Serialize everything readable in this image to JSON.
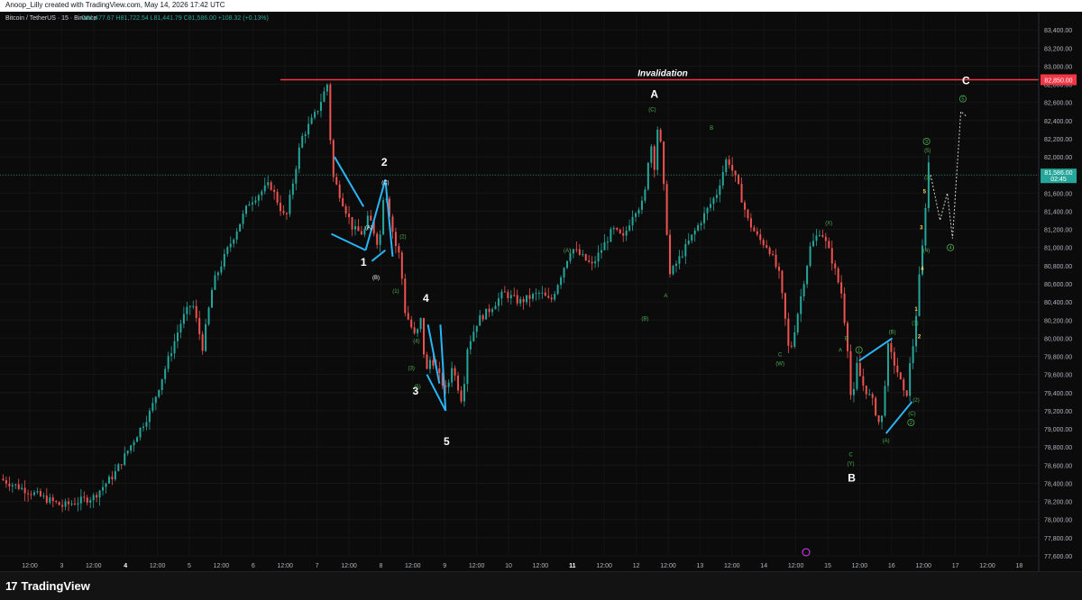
{
  "header": {
    "attribution": "Anoop_Lilly created with TradingView.com, May 14, 2026 17:42 UTC"
  },
  "symbol_line": {
    "name": "Bitcoin / TetherUS · 15 · Binance",
    "ohlc": [
      {
        "label": "O",
        "value": "81,477.67"
      },
      {
        "label": "H",
        "value": "81,722.54"
      },
      {
        "label": "L",
        "value": "81,441.79"
      },
      {
        "label": "C",
        "value": "81,586.00"
      }
    ],
    "change": "+108.32 (+0.13%)"
  },
  "footer": {
    "logo_mark": "17",
    "logo_text": "TradingView"
  },
  "colors": {
    "background": "#0b0b0b",
    "up": "#26a69a",
    "down": "#ef5350",
    "wave_line": "#29b6f6",
    "invalidation": "#f23645",
    "label_green": "#4caf50",
    "label_yellow": "#ffd54f",
    "label_white": "#ffffff"
  },
  "chart_data": {
    "type": "candlestick",
    "ylim": [
      77600,
      83600
    ],
    "y_ticks": [
      77600,
      77800,
      78000,
      78200,
      78400,
      78600,
      78800,
      79000,
      79200,
      79400,
      79600,
      79800,
      80000,
      80200,
      80400,
      80600,
      80800,
      81000,
      81200,
      81400,
      81600,
      81800,
      82000,
      82200,
      82400,
      82600,
      82800,
      83000,
      83200,
      83400
    ],
    "y_tick_labels": [
      "77,600.00",
      "77,800.00",
      "78,000.00",
      "78,200.00",
      "78,400.00",
      "78,600.00",
      "78,800.00",
      "79,000.00",
      "79,200.00",
      "79,400.00",
      "79,600.00",
      "79,800.00",
      "80,000.00",
      "80,200.00",
      "80,400.00",
      "80,600.00",
      "80,800.00",
      "81,000.00",
      "81,200.00",
      "81,400.00",
      "81,600.00",
      "81,800.00",
      "82,000.00",
      "82,200.00",
      "82,400.00",
      "82,600.00",
      "82,800.00",
      "83,000.00",
      "83,200.00",
      "83,400.00"
    ],
    "x_tick_labels": [
      "12:00",
      "3",
      "12:00",
      "4",
      "12:00",
      "5",
      "12:00",
      "6",
      "12:00",
      "7",
      "12:00",
      "8",
      "12:00",
      "9",
      "12:00",
      "10",
      "12:00",
      "11",
      "12:00",
      "12",
      "12:00",
      "13",
      "12:00",
      "14",
      "12:00",
      "15",
      "12:00",
      "16",
      "12:00",
      "17",
      "12:00",
      "18"
    ],
    "x_tick_bold": [
      "4",
      "11"
    ],
    "price_path": [
      [
        0,
        78450
      ],
      [
        3,
        78300
      ],
      [
        6,
        78150
      ],
      [
        9,
        78250
      ],
      [
        11,
        78500
      ],
      [
        13,
        78900
      ],
      [
        14.5,
        79200
      ],
      [
        16,
        79700
      ],
      [
        17.5,
        80200
      ],
      [
        18.5,
        80400
      ],
      [
        19.5,
        79900
      ],
      [
        20.5,
        80600
      ],
      [
        22,
        81000
      ],
      [
        24,
        81500
      ],
      [
        26,
        81700
      ],
      [
        27.5,
        81300
      ],
      [
        29,
        82200
      ],
      [
        30.5,
        82500
      ],
      [
        31.5,
        82800
      ],
      [
        32,
        81800
      ],
      [
        33,
        81500
      ],
      [
        34,
        81200
      ],
      [
        35,
        81150
      ],
      [
        35.5,
        81350
      ],
      [
        36.5,
        81000
      ],
      [
        37,
        81700
      ],
      [
        38,
        81050
      ],
      [
        38.5,
        80900
      ],
      [
        39,
        80300
      ],
      [
        40,
        80000
      ],
      [
        40.5,
        80200
      ],
      [
        41,
        79600
      ],
      [
        41.5,
        79800
      ],
      [
        42,
        79650
      ],
      [
        43,
        79400
      ],
      [
        43.5,
        79700
      ],
      [
        44.5,
        79300
      ],
      [
        45,
        79900
      ],
      [
        46,
        80200
      ],
      [
        47,
        80300
      ],
      [
        48.5,
        80500
      ],
      [
        50,
        80400
      ],
      [
        52,
        80500
      ],
      [
        53,
        80400
      ],
      [
        54,
        80700
      ],
      [
        55,
        81000
      ],
      [
        56,
        80900
      ],
      [
        57,
        80800
      ],
      [
        58,
        81000
      ],
      [
        59,
        81200
      ],
      [
        60,
        81100
      ],
      [
        61,
        81400
      ],
      [
        62,
        81500
      ],
      [
        62.6,
        82200
      ],
      [
        63,
        81900
      ],
      [
        63.4,
        82450
      ],
      [
        64,
        81500
      ],
      [
        64.5,
        80700
      ],
      [
        65,
        80800
      ],
      [
        66,
        81000
      ],
      [
        67,
        81200
      ],
      [
        68,
        81400
      ],
      [
        69,
        81600
      ],
      [
        70,
        82000
      ],
      [
        71,
        81700
      ],
      [
        72,
        81300
      ],
      [
        73,
        81100
      ],
      [
        74,
        81000
      ],
      [
        75,
        80700
      ],
      [
        75.5,
        80300
      ],
      [
        76,
        79800
      ],
      [
        77,
        80400
      ],
      [
        78,
        81000
      ],
      [
        79,
        81200
      ],
      [
        80,
        80900
      ],
      [
        81,
        80500
      ],
      [
        81.6,
        79900
      ],
      [
        82,
        79200
      ],
      [
        82.5,
        79700
      ],
      [
        83,
        79500
      ],
      [
        84,
        79300
      ],
      [
        84.8,
        79000
      ],
      [
        85.5,
        79900
      ],
      [
        86.5,
        79600
      ],
      [
        87.2,
        79300
      ],
      [
        87.6,
        79700
      ],
      [
        88,
        80000
      ],
      [
        88.6,
        80800
      ],
      [
        89,
        81200
      ],
      [
        89.3,
        82000
      ],
      [
        89.6,
        81800
      ]
    ],
    "forecast_path": [
      [
        89.6,
        81800
      ],
      [
        90.5,
        81300
      ],
      [
        91.2,
        81600
      ],
      [
        91.7,
        81100
      ],
      [
        92.5,
        82500
      ],
      [
        93,
        82450
      ]
    ],
    "invalidation_level": 82850,
    "current_price_label": "81,586.00",
    "current_price_countdown": "02:45",
    "invalidation_price_label": "82,850.00",
    "annotation_text": "Invalidation",
    "wave_labels_major": [
      {
        "t": "1",
        "x": 35,
        "y": 80800
      },
      {
        "t": "2",
        "x": 37,
        "y": 81900
      },
      {
        "t": "3",
        "x": 40,
        "y": 79380
      },
      {
        "t": "4",
        "x": 41,
        "y": 80400
      },
      {
        "t": "5",
        "x": 43,
        "y": 78820
      },
      {
        "t": "A",
        "x": 63,
        "y": 82650
      },
      {
        "t": "B",
        "x": 82,
        "y": 78420
      },
      {
        "t": "C",
        "x": 93,
        "y": 82800
      }
    ],
    "wave_labels_minor_white": [
      {
        "t": "(A)",
        "x": 35.5,
        "y": 81200
      },
      {
        "t": "(B)",
        "x": 36.2,
        "y": 80650
      },
      {
        "t": "(C)",
        "x": 37.1,
        "y": 81700
      }
    ],
    "wave_labels_minor_green": [
      {
        "t": "(2)",
        "x": 38.8,
        "y": 81100
      },
      {
        "t": "(1)",
        "x": 38.1,
        "y": 80500
      },
      {
        "t": "(4)",
        "x": 40.1,
        "y": 79950
      },
      {
        "t": "(3)",
        "x": 39.6,
        "y": 79650
      },
      {
        "t": "(5)",
        "x": 40.2,
        "y": 79450
      },
      {
        "t": "(A)",
        "x": 54.6,
        "y": 80950
      },
      {
        "t": "(B)",
        "x": 62.1,
        "y": 80200
      },
      {
        "t": "(C)",
        "x": 62.8,
        "y": 82500
      },
      {
        "t": "A",
        "x": 64.1,
        "y": 80450
      },
      {
        "t": "B",
        "x": 68.5,
        "y": 82300
      },
      {
        "t": "(X)",
        "x": 79.8,
        "y": 81250
      },
      {
        "t": "C",
        "x": 75.1,
        "y": 79800
      },
      {
        "t": "(W)",
        "x": 75.1,
        "y": 79700
      },
      {
        "t": "A",
        "x": 80.9,
        "y": 79850
      },
      {
        "t": "B",
        "x": 81.5,
        "y": 79980
      },
      {
        "t": "C",
        "x": 81.9,
        "y": 78700
      },
      {
        "t": "(Y)",
        "x": 81.9,
        "y": 78600
      },
      {
        "t": "(B)",
        "x": 85.9,
        "y": 80050
      },
      {
        "t": "(A)",
        "x": 85.3,
        "y": 78850
      },
      {
        "t": "(C)",
        "x": 87.8,
        "y": 79150
      },
      {
        "t": "(2)",
        "x": 88.2,
        "y": 79300
      },
      {
        "t": "(1)",
        "x": 88.1,
        "y": 80150
      },
      {
        "t": "(4)",
        "x": 89.2,
        "y": 80950
      },
      {
        "t": "(5)",
        "x": 89.3,
        "y": 82050
      },
      {
        "t": "(3)",
        "x": 89.3,
        "y": 81750
      }
    ],
    "wave_labels_circled": [
      {
        "t": "1",
        "x": 82.7,
        "y": 79850
      },
      {
        "t": "2",
        "x": 87.7,
        "y": 79050
      },
      {
        "t": "3",
        "x": 89.2,
        "y": 82150
      },
      {
        "t": "4",
        "x": 91.5,
        "y": 80980
      },
      {
        "t": "5",
        "x": 92.7,
        "y": 82620
      }
    ],
    "wave_labels_yellow": [
      {
        "t": "1",
        "x": 88.2,
        "y": 80300
      },
      {
        "t": "2",
        "x": 88.5,
        "y": 80000
      },
      {
        "t": "3",
        "x": 88.7,
        "y": 81200
      },
      {
        "t": "4",
        "x": 88.8,
        "y": 80750
      },
      {
        "t": "5",
        "x": 89.0,
        "y": 81600
      }
    ],
    "blue_lines": [
      [
        [
          32.2,
          82000
        ],
        [
          35,
          81450
        ]
      ],
      [
        [
          31.9,
          81150
        ],
        [
          35.2,
          80970
        ]
      ],
      [
        [
          35.2,
          80970
        ],
        [
          37.1,
          81750
        ]
      ],
      [
        [
          37.1,
          81750
        ],
        [
          37.8,
          80900
        ]
      ],
      [
        [
          35.8,
          80850
        ],
        [
          37.1,
          80970
        ]
      ],
      [
        [
          41.2,
          80150
        ],
        [
          42.3,
          79500
        ]
      ],
      [
        [
          41.1,
          79600
        ],
        [
          42.9,
          79200
        ]
      ],
      [
        [
          42.9,
          79200
        ],
        [
          42.4,
          80150
        ]
      ],
      [
        [
          85.3,
          78950
        ],
        [
          87.8,
          79300
        ]
      ],
      [
        [
          82.7,
          79750
        ],
        [
          85.9,
          80000
        ]
      ]
    ]
  }
}
